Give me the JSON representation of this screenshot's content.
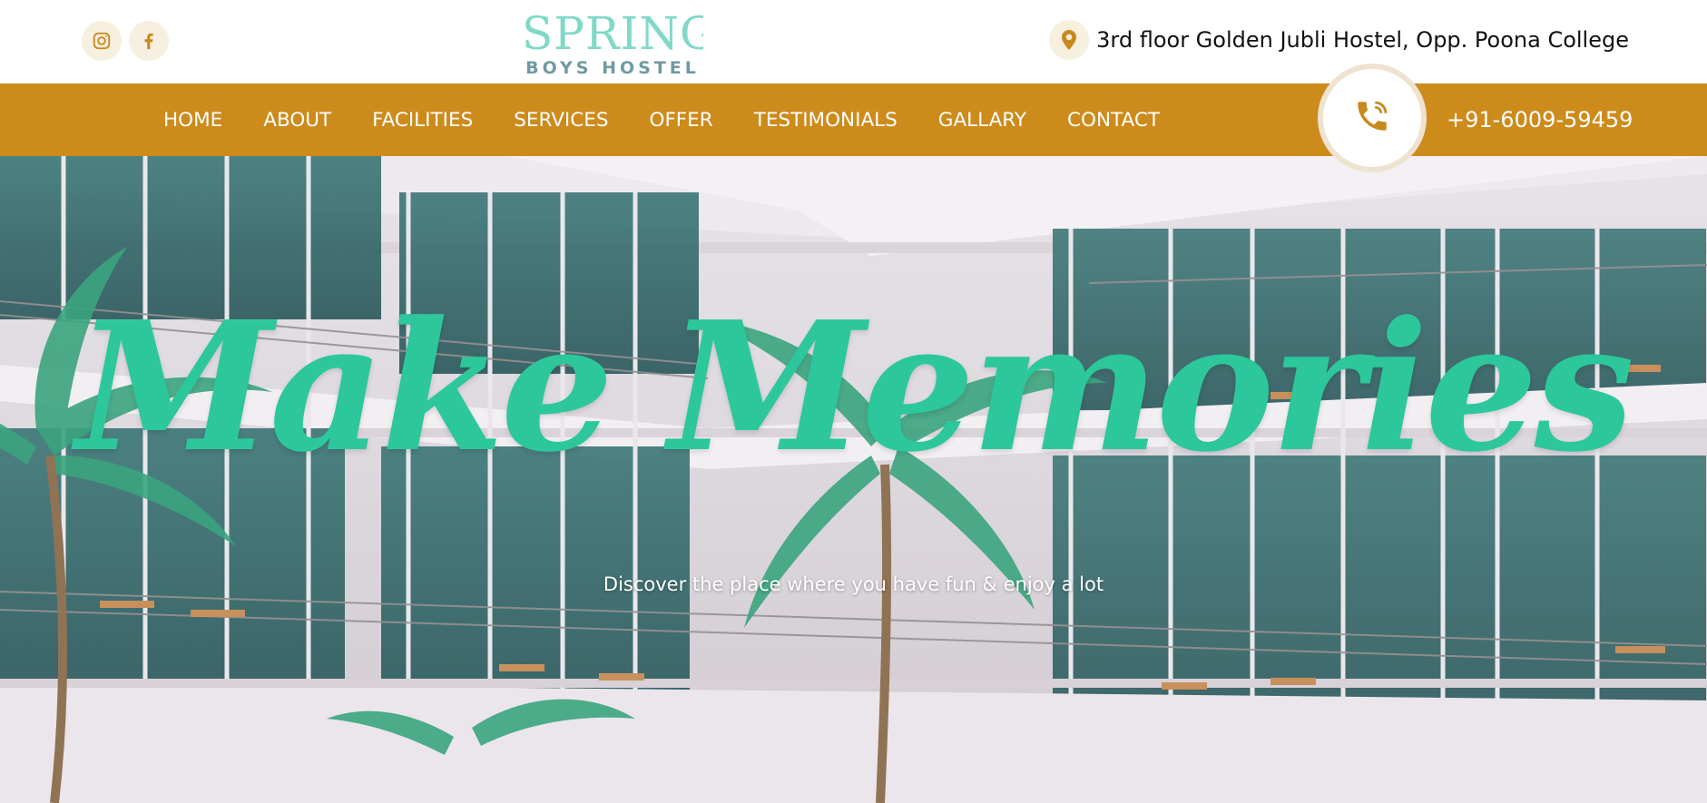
{
  "logo": {
    "main": "SPRING",
    "sub": "BOYS HOSTEL"
  },
  "social": [
    {
      "name": "instagram",
      "icon": "instagram-icon"
    },
    {
      "name": "facebook",
      "icon": "facebook-icon"
    }
  ],
  "contact": {
    "address": "3rd floor Golden Jubli Hostel, Opp. Poona College",
    "phone": "+91-6009-59459"
  },
  "nav": {
    "items": [
      {
        "label": "HOME"
      },
      {
        "label": "ABOUT"
      },
      {
        "label": "FACILITIES"
      },
      {
        "label": "SERVICES"
      },
      {
        "label": "OFFER"
      },
      {
        "label": "TESTIMONIALS"
      },
      {
        "label": "GALLARY"
      },
      {
        "label": "CONTACT"
      }
    ]
  },
  "hero": {
    "headline": "Make Memories",
    "subline": "Discover the place where you have fun & enjoy a lot"
  },
  "colors": {
    "accent": "#cd8b1c",
    "headline": "#2dc79c",
    "icon_bg": "#f7efdf",
    "logo": "#7fd9c6"
  }
}
